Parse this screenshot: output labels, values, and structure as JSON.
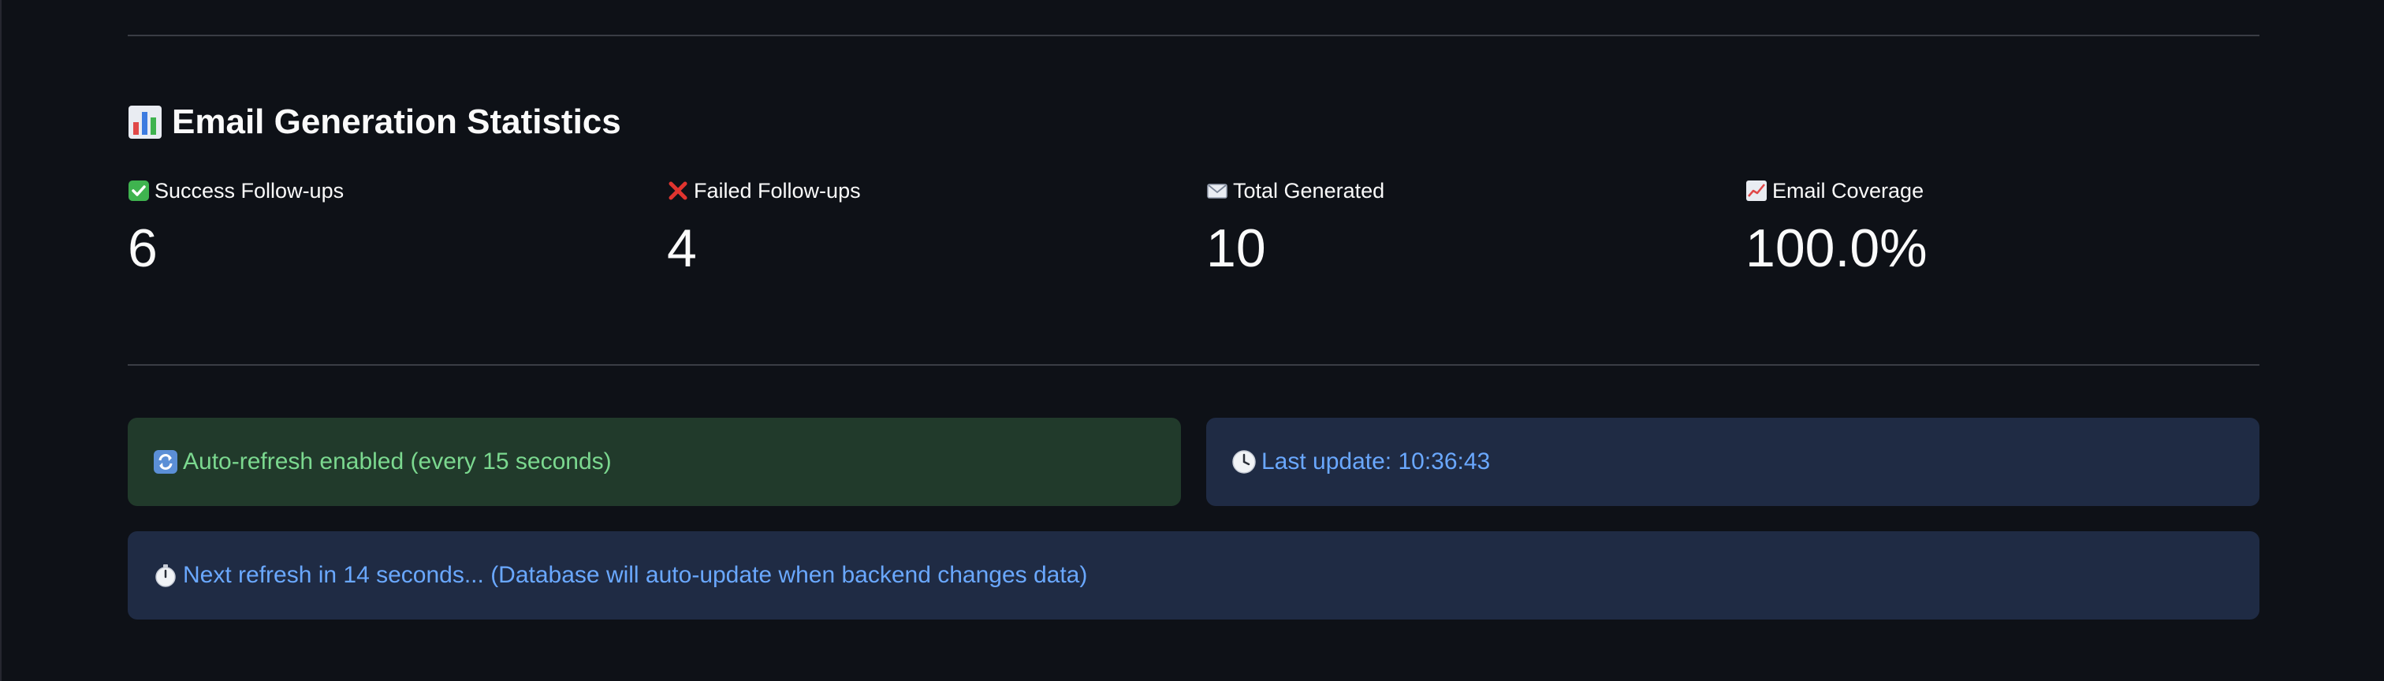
{
  "header": {
    "title": "Email Generation Statistics",
    "icon": "bar-chart-icon"
  },
  "metrics": [
    {
      "icon": "check-mark-icon",
      "label": "Success Follow-ups",
      "value": "6"
    },
    {
      "icon": "cross-mark-icon",
      "label": "Failed Follow-ups",
      "value": "4"
    },
    {
      "icon": "email-icon",
      "label": "Total Generated",
      "value": "10"
    },
    {
      "icon": "trend-chart-icon",
      "label": "Email Coverage",
      "value": "100.0%"
    }
  ],
  "alerts": {
    "auto_refresh": {
      "icon": "refresh-icon",
      "text": "Auto-refresh enabled (every 15 seconds)"
    },
    "last_update": {
      "icon": "clock-icon",
      "text": "Last update: 10:36:43"
    },
    "next_refresh": {
      "icon": "stopwatch-icon",
      "text": "Next refresh in 14 seconds... (Database will auto-update when backend changes data)"
    }
  },
  "colors": {
    "background": "#0e1117",
    "success_bg": "#213a2b",
    "success_text": "#7bd88f",
    "info_bg": "#1f2b44",
    "info_text": "#6aa8ff"
  }
}
